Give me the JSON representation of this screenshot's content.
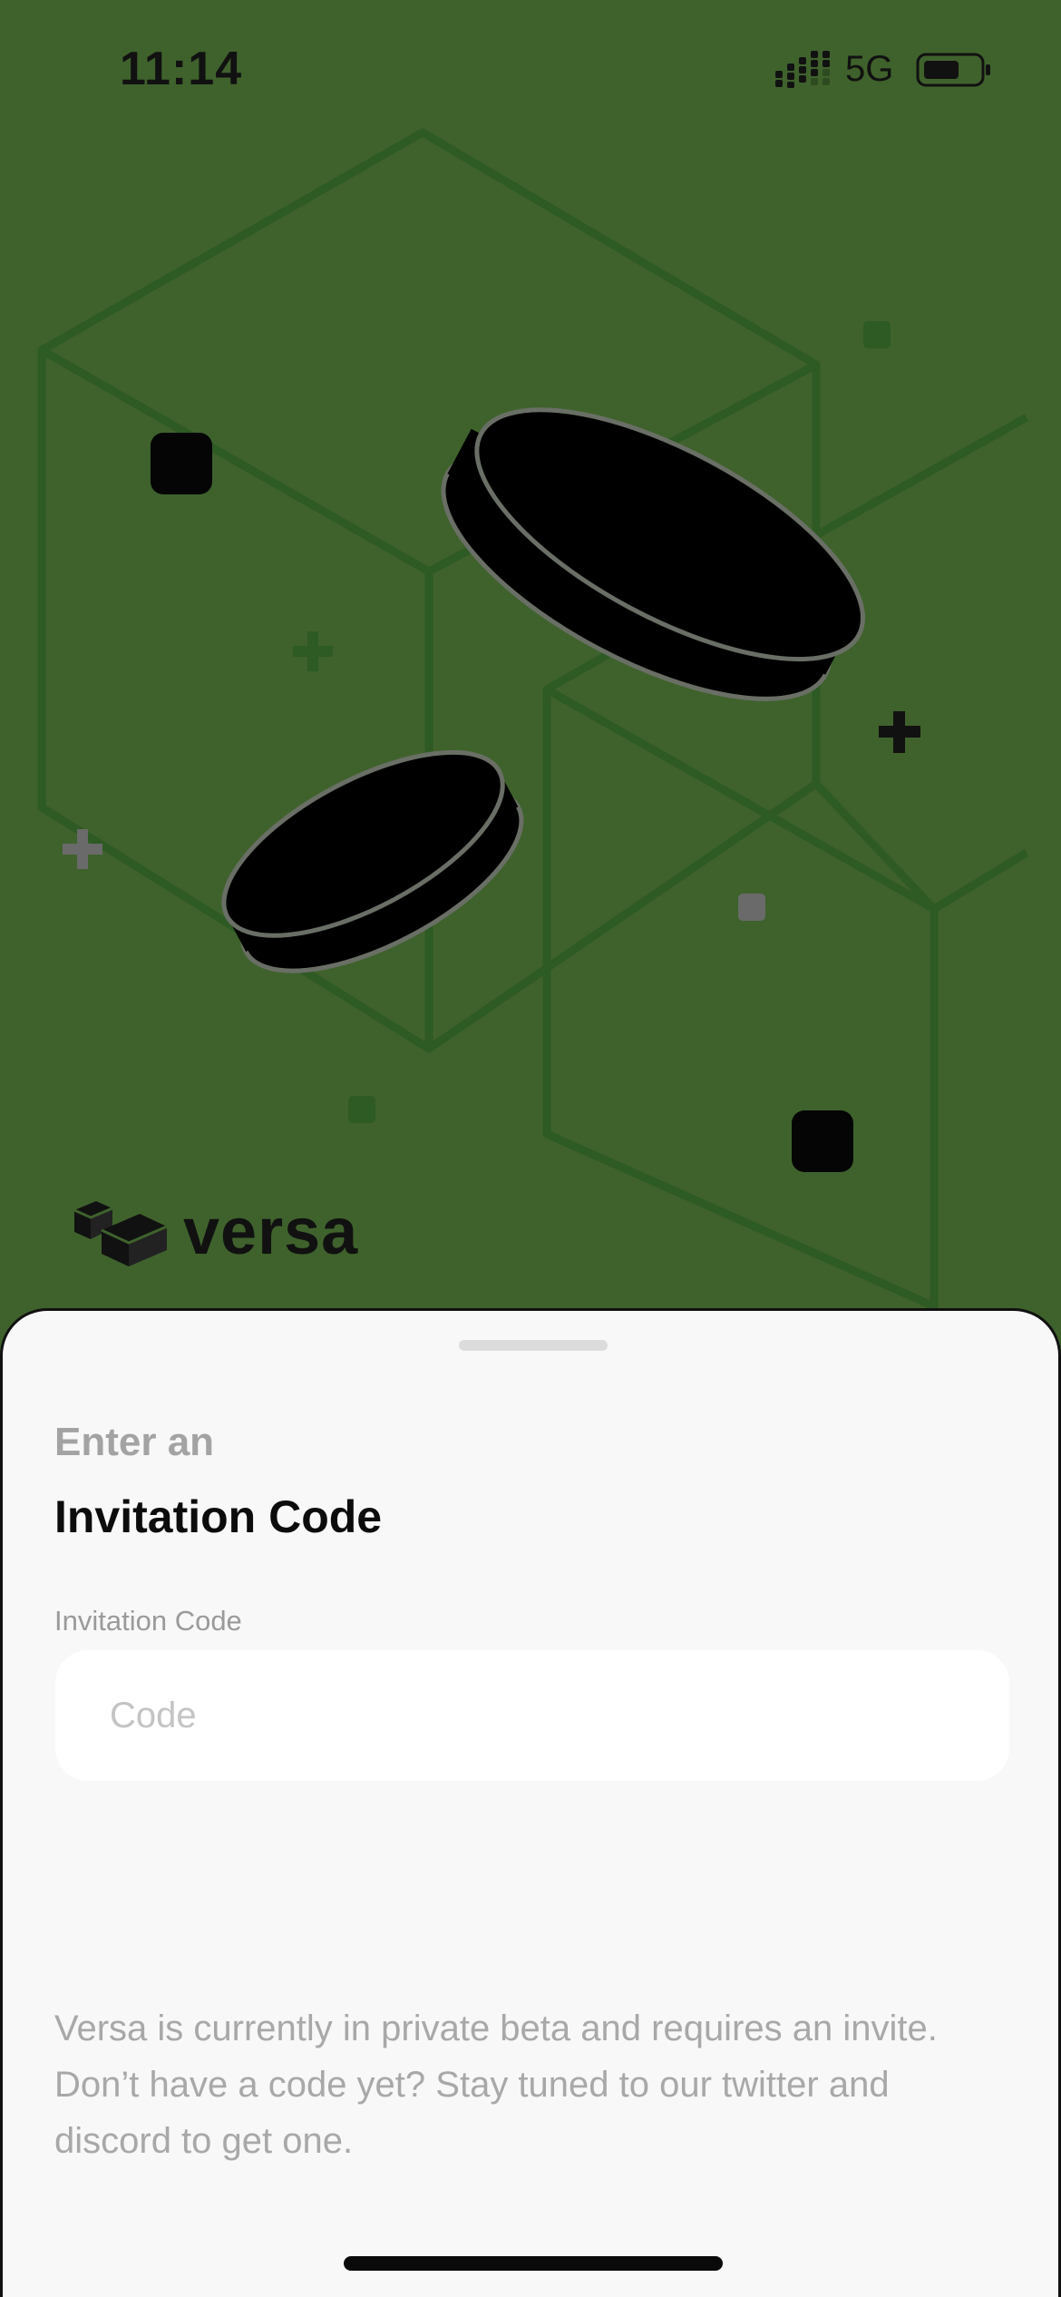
{
  "status_bar": {
    "time": "11:14",
    "network": "5G",
    "icons": [
      "signal-icon",
      "battery-icon"
    ]
  },
  "brand": {
    "name": "versa",
    "icon": "blocks-logo-icon"
  },
  "colors": {
    "background": "#3f622c",
    "sheet": "#f8f8f8",
    "title": "#0c0c0c",
    "muted": "#a3a3a3"
  },
  "sheet": {
    "subtitle": "Enter an",
    "title": "Invitation Code",
    "field_label": "Invitation Code",
    "input_placeholder": "Code",
    "input_value": "",
    "info": "Versa is currently in private beta and requires an invite. Don’t have a code yet? Stay tuned to our twitter and discord to get one."
  }
}
